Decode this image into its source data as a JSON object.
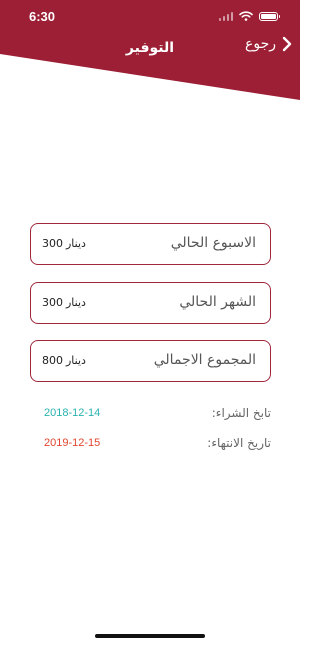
{
  "colors": {
    "brand": "#9c1f35",
    "card_border": "#a0263a",
    "purchase_date": "#2bb3b0",
    "expiry_date": "#e0452f"
  },
  "status_bar": {
    "time": "6:30",
    "icons": [
      "cellular-signal-icon",
      "wifi-icon",
      "battery-icon"
    ]
  },
  "nav": {
    "title": "التوفير",
    "back_label": "رجوع",
    "back_icon": "chevron-right-icon"
  },
  "cards": [
    {
      "label": "الاسبوع الحالي",
      "amount": "300",
      "currency": "دينار"
    },
    {
      "label": "الشهر الحالي",
      "amount": "300",
      "currency": "دينار"
    },
    {
      "label": "المجموع الاجمالي",
      "amount": "800",
      "currency": "دينار"
    }
  ],
  "dates": {
    "purchase_label": "تابخ الشراء:",
    "purchase_value": "2018-12-14",
    "expiry_label": "تاريخ الانتهاء:",
    "expiry_value": "2019-12-15"
  }
}
